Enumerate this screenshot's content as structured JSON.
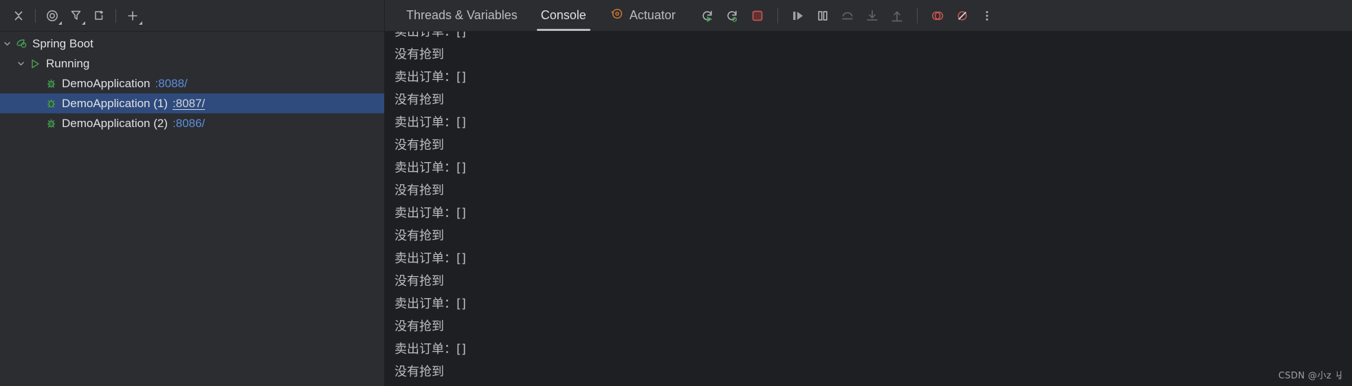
{
  "toolbar": {
    "left_buttons": [
      {
        "name": "close-icon",
        "label": "Close",
        "has_dropdown": false
      },
      {
        "name": "watches-icon",
        "label": "Watches",
        "has_dropdown": true
      },
      {
        "name": "filter-icon",
        "label": "Filter",
        "has_dropdown": true
      },
      {
        "name": "add-to-watches-icon",
        "label": "Add to Watches",
        "has_dropdown": false
      },
      {
        "name": "add-icon",
        "label": "Add",
        "has_dropdown": true
      }
    ]
  },
  "tabs": [
    {
      "id": "threads-variables",
      "label": "Threads & Variables",
      "active": false,
      "icon": null
    },
    {
      "id": "console",
      "label": "Console",
      "active": true,
      "icon": null
    },
    {
      "id": "actuator",
      "label": "Actuator",
      "active": false,
      "icon": "actuator-icon"
    }
  ],
  "run_controls": [
    {
      "name": "rerun-icon",
      "label": "Rerun",
      "disabled": false
    },
    {
      "name": "rerun-debug-icon",
      "label": "Rerun with Debugger",
      "disabled": false
    },
    {
      "name": "stop-icon",
      "label": "Stop",
      "disabled": false
    },
    {
      "name": "resume-program-icon",
      "label": "Resume Program",
      "disabled": false
    },
    {
      "name": "pause-program-icon",
      "label": "Pause Program",
      "disabled": false
    },
    {
      "name": "step-over-icon",
      "label": "Step Over",
      "disabled": true
    },
    {
      "name": "step-into-icon",
      "label": "Step Into",
      "disabled": true
    },
    {
      "name": "step-out-icon",
      "label": "Step Out",
      "disabled": true
    },
    {
      "name": "view-breakpoints-icon",
      "label": "View Breakpoints",
      "disabled": false
    },
    {
      "name": "mute-breakpoints-icon",
      "label": "Mute Breakpoints",
      "disabled": false
    },
    {
      "name": "more-options-icon",
      "label": "More",
      "disabled": false
    }
  ],
  "tree": [
    {
      "id": "spring-boot",
      "label": "Spring Boot",
      "level": 0,
      "icon": "spring-boot-leaf-icon",
      "expanded": true,
      "selected": false,
      "port": ""
    },
    {
      "id": "running",
      "label": "Running",
      "level": 1,
      "icon": "run-triangle-icon",
      "expanded": true,
      "selected": false,
      "port": ""
    },
    {
      "id": "demoapplication",
      "label": "DemoApplication",
      "level": 2,
      "icon": "debug-bug-icon",
      "expanded": null,
      "selected": false,
      "port": ":8088/"
    },
    {
      "id": "demoapplication-1",
      "label": "DemoApplication (1)",
      "level": 2,
      "icon": "debug-bug-icon",
      "expanded": null,
      "selected": true,
      "port": ":8087/"
    },
    {
      "id": "demoapplication-2",
      "label": "DemoApplication (2)",
      "level": 2,
      "icon": "debug-bug-icon",
      "expanded": null,
      "selected": false,
      "port": ":8086/"
    }
  ],
  "console": {
    "lines": [
      "卖出订单：[]",
      "没有抢到",
      "卖出订单：[]",
      "没有抢到",
      "卖出订单：[]",
      "没有抢到",
      "卖出订单：[]",
      "没有抢到",
      "卖出订单：[]",
      "没有抢到",
      "卖出订单：[]",
      "没有抢到",
      "卖出订单：[]",
      "没有抢到",
      "卖出订单：[]",
      "没有抢到"
    ]
  },
  "watermark": "CSDN @小z ㆢ",
  "colors": {
    "background": "#2b2d30",
    "console_background": "#1e1f22",
    "selection": "#2f4b7d",
    "link": "#5f8ede",
    "text": "#dfe1e5",
    "console_text": "#bcbec4",
    "green_accent": "#499c54",
    "red_accent": "#c75450",
    "orange_accent": "#cc7832"
  }
}
